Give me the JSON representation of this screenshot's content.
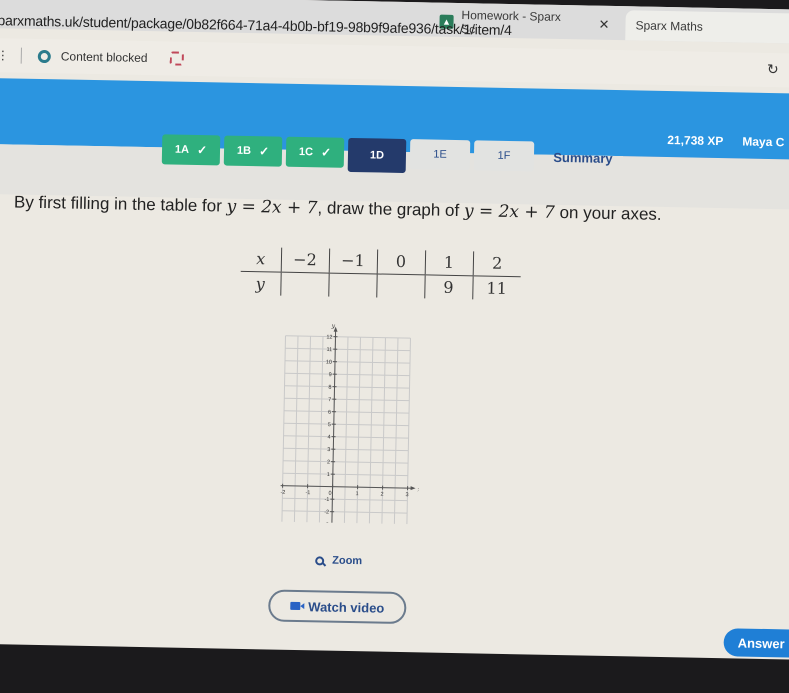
{
  "browser": {
    "tabs": [
      {
        "title": "Homework - Sparx Sc",
        "favicon": "sparx-homework-icon",
        "active": false
      },
      {
        "title": "Sparx Maths",
        "favicon": "sparx-s-icon",
        "active": true
      }
    ],
    "tab_close_glyph": "✕",
    "favicon_s": "S",
    "url": "parxmaths.uk/student/package/0b82f664-71a4-4b0b-bf19-98b9f9afe936/task/1/item/4",
    "bookmarks": {
      "content_blocked_label": "Content blocked"
    },
    "reload_glyph": "↻"
  },
  "header": {
    "xp": "21,738 XP",
    "user": "Maya C"
  },
  "task_tabs": [
    {
      "label": "1A",
      "status": "done"
    },
    {
      "label": "1B",
      "status": "done"
    },
    {
      "label": "1C",
      "status": "done"
    },
    {
      "label": "1D",
      "status": "current"
    },
    {
      "label": "1E",
      "status": "todo"
    },
    {
      "label": "1F",
      "status": "todo"
    },
    {
      "label": "Summary",
      "status": "summary"
    }
  ],
  "check_glyph": "✓",
  "question": {
    "part1": "By first filling in the table for ",
    "eq1": "y = 2x + 7",
    "part2": ", draw the graph of ",
    "eq2": "y = 2x + 7",
    "part3": " on your axes."
  },
  "value_table": {
    "x_label": "x",
    "y_label": "y",
    "x_values": [
      "−2",
      "−1",
      "0",
      "1",
      "2"
    ],
    "y_values": [
      "",
      "",
      "",
      "9",
      "11"
    ]
  },
  "graph": {
    "x_axis_label": "x",
    "y_axis_label": "y",
    "x_ticks": [
      "-2",
      "-1",
      "0",
      "1",
      "2",
      "3"
    ],
    "y_ticks": [
      "12",
      "11",
      "10",
      "9",
      "8",
      "7",
      "6",
      "5",
      "4",
      "3",
      "2",
      "1",
      "-1",
      "-2",
      "-3"
    ],
    "x_range": [
      -2,
      3
    ],
    "y_range": [
      -3,
      12
    ]
  },
  "actions": {
    "zoom_label": "Zoom",
    "watch_video_label": "Watch video",
    "answer_label": "Answer"
  }
}
